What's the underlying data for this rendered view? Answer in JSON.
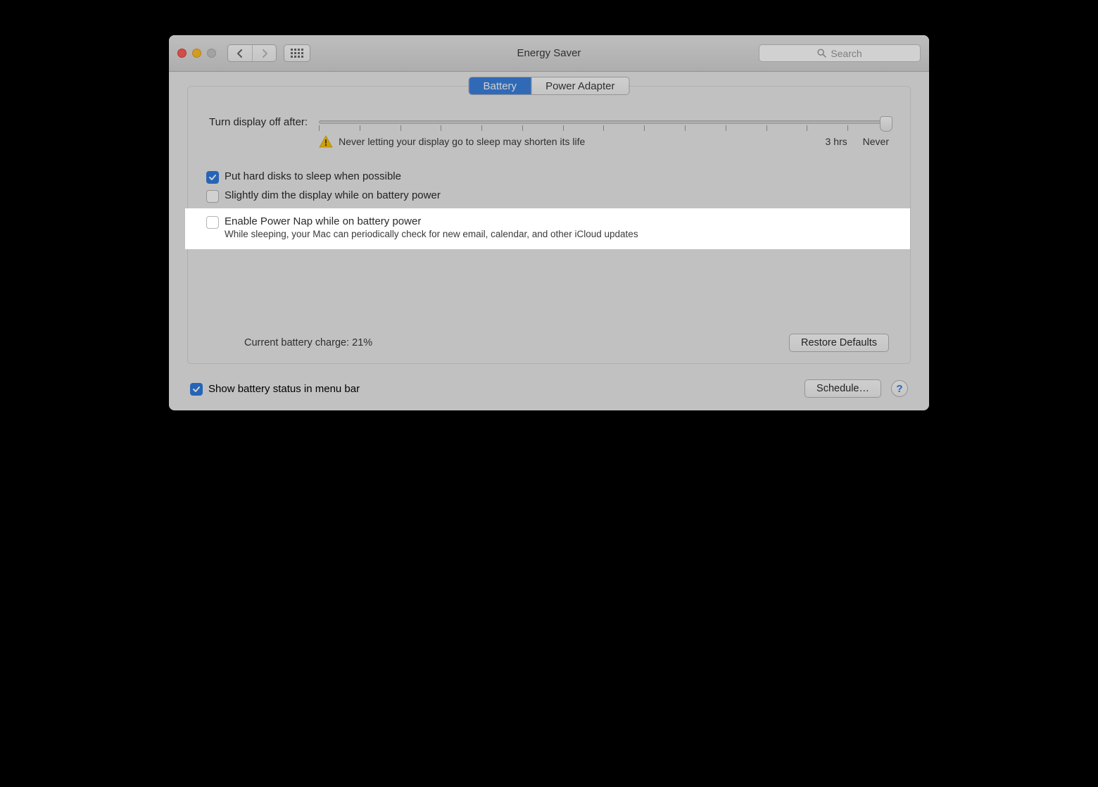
{
  "window": {
    "title": "Energy Saver"
  },
  "search": {
    "placeholder": "Search"
  },
  "tabs": {
    "battery": "Battery",
    "powerAdapter": "Power Adapter"
  },
  "slider": {
    "label": "Turn display off after:",
    "warning": "Never letting your display go to sleep may shorten its life",
    "labelLeft": "3 hrs",
    "labelRight": "Never"
  },
  "checks": {
    "hardDisks": "Put hard disks to sleep when possible",
    "dimDisplay": "Slightly dim the display while on battery power",
    "powerNap": "Enable Power Nap while on battery power",
    "powerNapSub": "While sleeping, your Mac can periodically check for new email, calendar, and other iCloud updates"
  },
  "status": {
    "charge": "Current battery charge: 21%"
  },
  "buttons": {
    "restore": "Restore Defaults",
    "schedule": "Schedule…"
  },
  "footer": {
    "showBattery": "Show battery status in menu bar"
  },
  "help": "?"
}
